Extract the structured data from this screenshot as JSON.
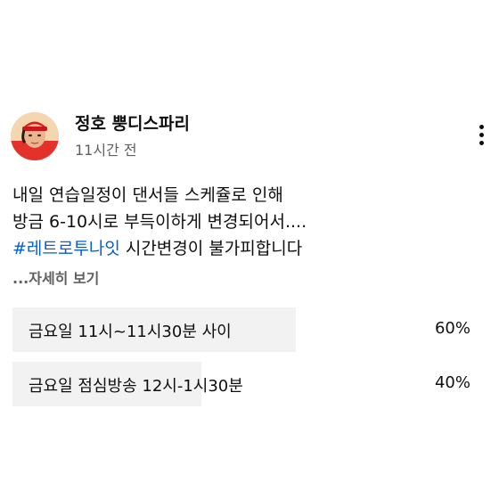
{
  "post": {
    "channel_name": "정호 뿡디스파리",
    "timestamp": "11시간 전",
    "body_lines": [
      "내일 연습일정이 댄서들 스케쥴로 인해",
      "방금 6-10시로 부득이하게 변경되어서...."
    ],
    "hashtag": "#레트로투나잇",
    "hashtag_suffix": " 시간변경이 불가피합니다",
    "read_more": "...자세히 보기",
    "icons": {
      "more": "more-vert-icon",
      "avatar": "channel-avatar"
    }
  },
  "poll": {
    "options": [
      {
        "label": "금요일 11시~11시30분 사이",
        "percent_text": "60%",
        "percent": 60
      },
      {
        "label": "금요일 점심방송 12시-1시30분",
        "percent_text": "40%",
        "percent": 40
      }
    ],
    "fill_color": "#f2f2f2"
  },
  "colors": {
    "link": "#065fd4",
    "secondary_text": "#606060",
    "text": "#0f0f0f"
  }
}
